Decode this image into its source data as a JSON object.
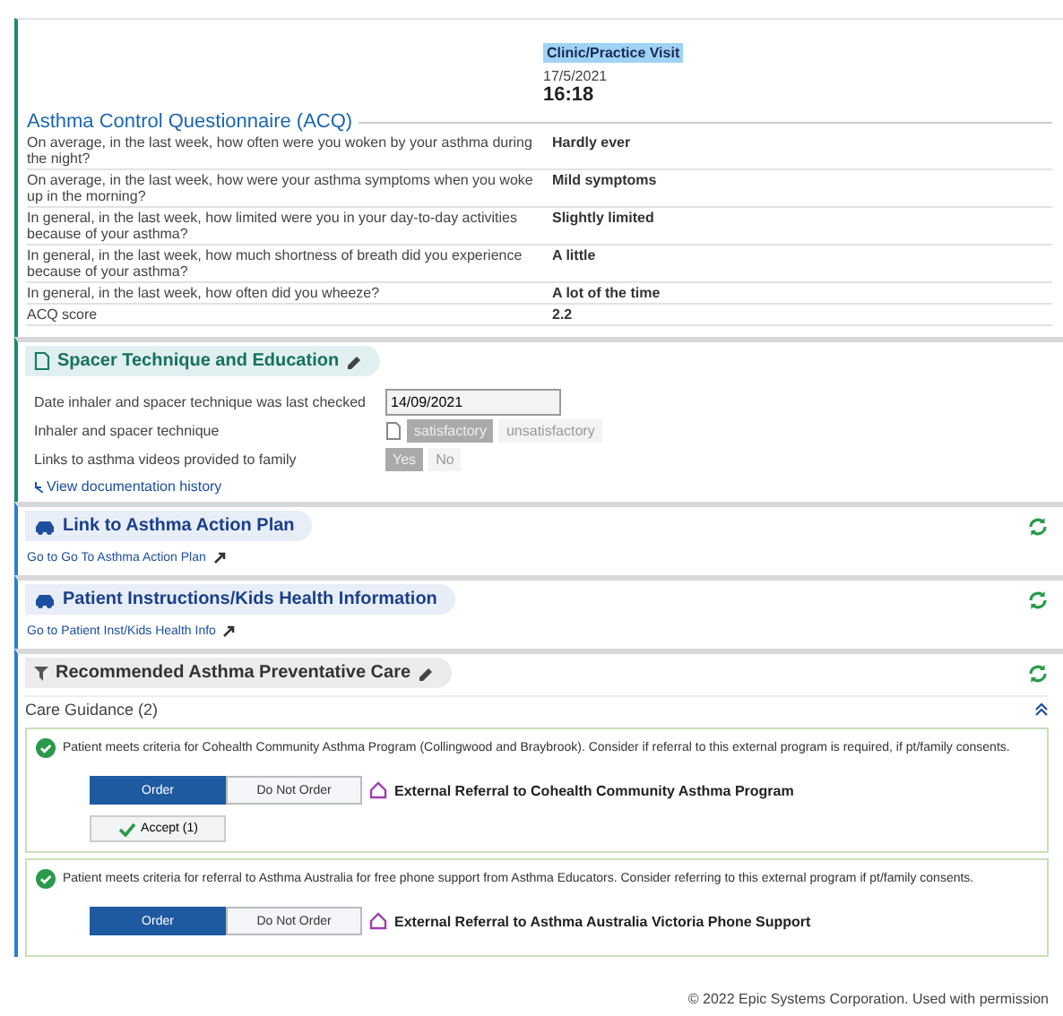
{
  "encounter": {
    "type": "Clinic/Practice Visit",
    "date": "17/5/2021",
    "time": "16:18"
  },
  "acq": {
    "title": "Asthma Control Questionnaire (ACQ)",
    "rows": [
      {
        "question": "On average, in the last week, how often were you woken by your asthma during the night?",
        "answer": "Hardly ever"
      },
      {
        "question": "On average, in the last week, how were your asthma symptoms when you woke up in the morning?",
        "answer": "Mild symptoms"
      },
      {
        "question": "In general, in the last week, how limited were you in your day-to-day activities because of your asthma?",
        "answer": "Slightly limited"
      },
      {
        "question": "In general, in the last week, how much shortness of breath did you experience because of your asthma?",
        "answer": "A little"
      },
      {
        "question": "In general, in the last week, how often did you wheeze?",
        "answer": "A lot of the time"
      },
      {
        "question": "ACQ score",
        "answer": "2.2"
      }
    ]
  },
  "spacer": {
    "title": "Spacer Technique and Education",
    "rows": [
      {
        "kind": "date",
        "label": "Date inhaler and spacer technique was last checked",
        "value": "14/09/2021"
      },
      {
        "kind": "choice",
        "label": "Inhaler and spacer technique",
        "options": [
          {
            "label": "satisfactory",
            "selected": true
          },
          {
            "label": "unsatisfactory",
            "selected": false
          }
        ]
      },
      {
        "kind": "choice",
        "label": "Links to asthma videos provided to family",
        "options": [
          {
            "label": "Yes",
            "selected": true
          },
          {
            "label": "No",
            "selected": false
          }
        ]
      }
    ],
    "history_link": "View documentation history"
  },
  "link_sections": [
    {
      "title": "Link to Asthma Action Plan",
      "link": "Go to Go To Asthma Action Plan"
    },
    {
      "title": "Patient Instructions/Kids Health Information",
      "link": "Go to Patient Inst/Kids Health Info"
    }
  ],
  "care": {
    "title": "Recommended Asthma Preventative Care",
    "guidance_title": "Care Guidance (2)",
    "items": [
      {
        "text": "Patient meets criteria for Cohealth Community Asthma Program (Collingwood and Braybrook). Consider if referral to this external program is required, if pt/family consents.",
        "options": [
          {
            "label": "Order",
            "selected": true
          },
          {
            "label": "Do Not Order",
            "selected": false
          }
        ],
        "order": "External Referral to Cohealth Community Asthma Program",
        "accept": "Accept  (1)"
      },
      {
        "text": "Patient meets criteria for referral to Asthma Australia for free phone support from Asthma Educators. Consider referring to this external program if pt/family consents.",
        "options": [
          {
            "label": "Order",
            "selected": true
          },
          {
            "label": "Do Not Order",
            "selected": false
          }
        ],
        "order": "External Referral to Asthma Australia Victoria Phone Support"
      }
    ]
  },
  "credit": "© 2022 Epic Systems Corporation. Used with permission"
}
